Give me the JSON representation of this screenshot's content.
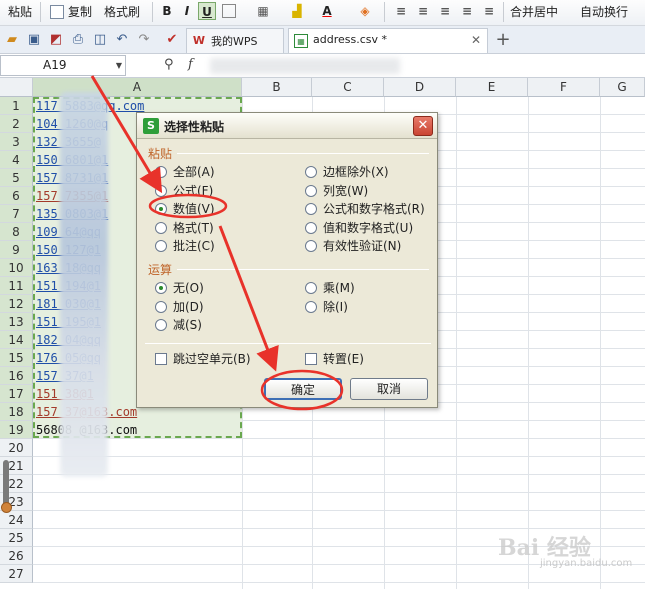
{
  "toolbar": {
    "paste_label": "粘贴",
    "copy_label": "复制",
    "format_painter_label": "格式刷",
    "bold": "B",
    "italic": "I",
    "underline": "U",
    "merge_center_label": "合并居中",
    "wrap_text_label": "自动换行"
  },
  "tabs": [
    {
      "label": "我的WPS",
      "icon": "wps-logo-icon",
      "active": false
    },
    {
      "label": "address.csv *",
      "icon": "spreadsheet-icon",
      "active": true
    }
  ],
  "new_tab_label": "+",
  "formula_bar": {
    "cell_ref": "A19",
    "fx": "f"
  },
  "columns": [
    "A",
    "B",
    "C",
    "D",
    "E",
    "F",
    "G"
  ],
  "rows": [
    "1",
    "2",
    "3",
    "4",
    "5",
    "6",
    "7",
    "8",
    "9",
    "10",
    "11",
    "12",
    "13",
    "14",
    "15",
    "16",
    "17",
    "18",
    "19",
    "20",
    "21",
    "22",
    "23",
    "24",
    "25",
    "26",
    "27"
  ],
  "cells": [
    {
      "row": 1,
      "text": "117    5883@qq.com",
      "style": "blue"
    },
    {
      "row": 2,
      "text": "104    1260@q",
      "style": "blue"
    },
    {
      "row": 3,
      "text": "132    3655@",
      "style": "blue"
    },
    {
      "row": 4,
      "text": "150    6801@1",
      "style": "blue"
    },
    {
      "row": 5,
      "text": "157    8731@1",
      "style": "blue"
    },
    {
      "row": 6,
      "text": "157    7355@1",
      "style": "red"
    },
    {
      "row": 7,
      "text": "135    0803@1",
      "style": "blue"
    },
    {
      "row": 8,
      "text": "109    64@qq",
      "style": "blue"
    },
    {
      "row": 9,
      "text": "150    127@1",
      "style": "blue"
    },
    {
      "row": 10,
      "text": "163    18@qq",
      "style": "blue"
    },
    {
      "row": 11,
      "text": "151    194@1",
      "style": "blue"
    },
    {
      "row": 12,
      "text": "181    030@1",
      "style": "blue"
    },
    {
      "row": 13,
      "text": "151    195@1",
      "style": "blue"
    },
    {
      "row": 14,
      "text": "182    04@qq",
      "style": "blue"
    },
    {
      "row": 15,
      "text": "176    05@qq",
      "style": "blue"
    },
    {
      "row": 16,
      "text": "157    37@1",
      "style": "blue"
    },
    {
      "row": 17,
      "text": "151    38@1",
      "style": "red"
    },
    {
      "row": 18,
      "text": "157    37@163.com",
      "style": "red"
    },
    {
      "row": 19,
      "text": "56808    @163.com",
      "style": "plain"
    }
  ],
  "dialog": {
    "title": "选择性粘贴",
    "paste_group": "粘贴",
    "paste_options": [
      {
        "label": "全部(A)",
        "checked": false
      },
      {
        "label": "公式(F)",
        "checked": false
      },
      {
        "label": "数值(V)",
        "checked": true
      },
      {
        "label": "格式(T)",
        "checked": false
      },
      {
        "label": "批注(C)",
        "checked": false
      }
    ],
    "paste_options_right": [
      {
        "label": "边框除外(X)",
        "checked": false
      },
      {
        "label": "列宽(W)",
        "checked": false
      },
      {
        "label": "公式和数字格式(R)",
        "checked": false
      },
      {
        "label": "值和数字格式(U)",
        "checked": false
      },
      {
        "label": "有效性验证(N)",
        "checked": false
      }
    ],
    "operation_group": "运算",
    "operation_options": [
      {
        "label": "无(O)",
        "checked": true
      },
      {
        "label": "加(D)",
        "checked": false
      },
      {
        "label": "减(S)",
        "checked": false
      }
    ],
    "operation_options_right": [
      {
        "label": "乘(M)",
        "checked": false
      },
      {
        "label": "除(I)",
        "checked": false
      }
    ],
    "skip_blanks_label": "跳过空单元(B)",
    "transpose_label": "转置(E)",
    "ok_label": "确定",
    "cancel_label": "取消"
  },
  "watermark": {
    "main": "Bai 经验",
    "sub": "jingyan.baidu.com"
  },
  "colors": {
    "accent_red": "#e8322a",
    "selection_green": "#6aa84f",
    "link_blue": "#1f4ea8"
  }
}
